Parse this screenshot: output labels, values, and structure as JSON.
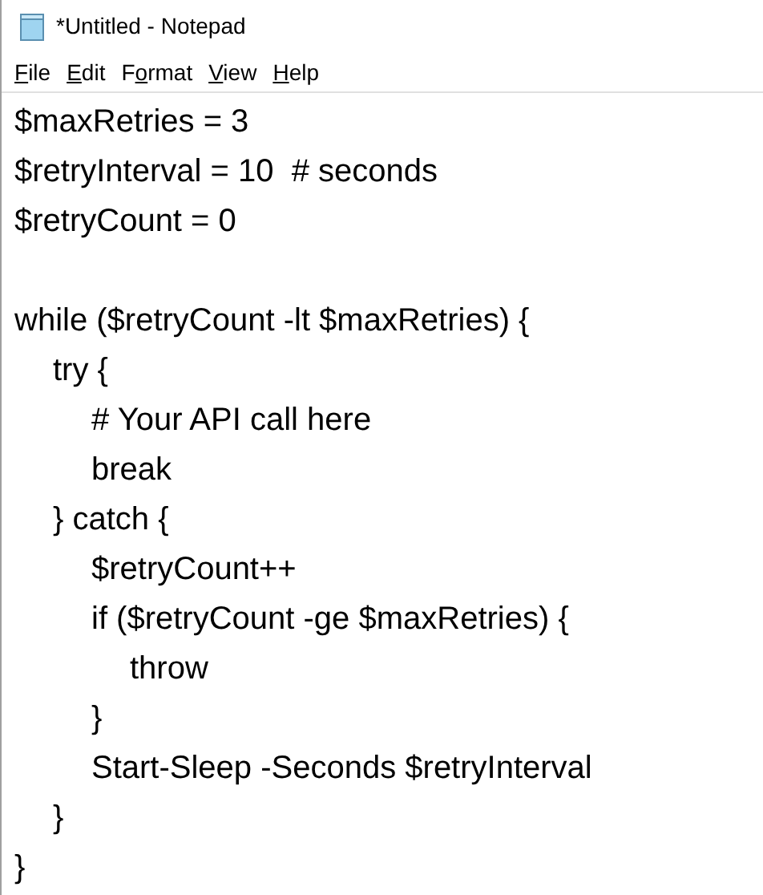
{
  "window": {
    "title": "*Untitled - Notepad"
  },
  "menu": [
    {
      "parts": [
        {
          "text": "F",
          "underline": true
        },
        {
          "text": "ile",
          "underline": false
        }
      ]
    },
    {
      "parts": [
        {
          "text": "E",
          "underline": true
        },
        {
          "text": "dit",
          "underline": false
        }
      ]
    },
    {
      "parts": [
        {
          "text": "F",
          "underline": false
        },
        {
          "text": "o",
          "underline": true
        },
        {
          "text": "rmat",
          "underline": false
        }
      ]
    },
    {
      "parts": [
        {
          "text": "V",
          "underline": true
        },
        {
          "text": "iew",
          "underline": false
        }
      ]
    },
    {
      "parts": [
        {
          "text": "H",
          "underline": true
        },
        {
          "text": "elp",
          "underline": false
        }
      ]
    }
  ],
  "editor": {
    "lines": [
      {
        "text": "$maxRetries = 3"
      },
      {
        "text": "$retryInterval = 10  # seconds"
      },
      {
        "text": "$retryCount = 0"
      },
      {
        "kind": "blank"
      },
      {
        "text": "while ($retryCount -lt $maxRetries) {",
        "children": [
          {
            "text": "try {",
            "children": [
              {
                "text": "# Your API call here"
              },
              {
                "text": "break"
              }
            ]
          },
          {
            "text": "} catch {",
            "children": [
              {
                "text": "$retryCount++"
              },
              {
                "text": "if ($retryCount -ge $maxRetries) {",
                "children": [
                  {
                    "text": "throw"
                  }
                ]
              },
              {
                "text": "}"
              },
              {
                "text": "Start-Sleep -Seconds $retryInterval"
              }
            ]
          },
          {
            "text": "}"
          }
        ]
      },
      {
        "text": "}"
      }
    ]
  }
}
